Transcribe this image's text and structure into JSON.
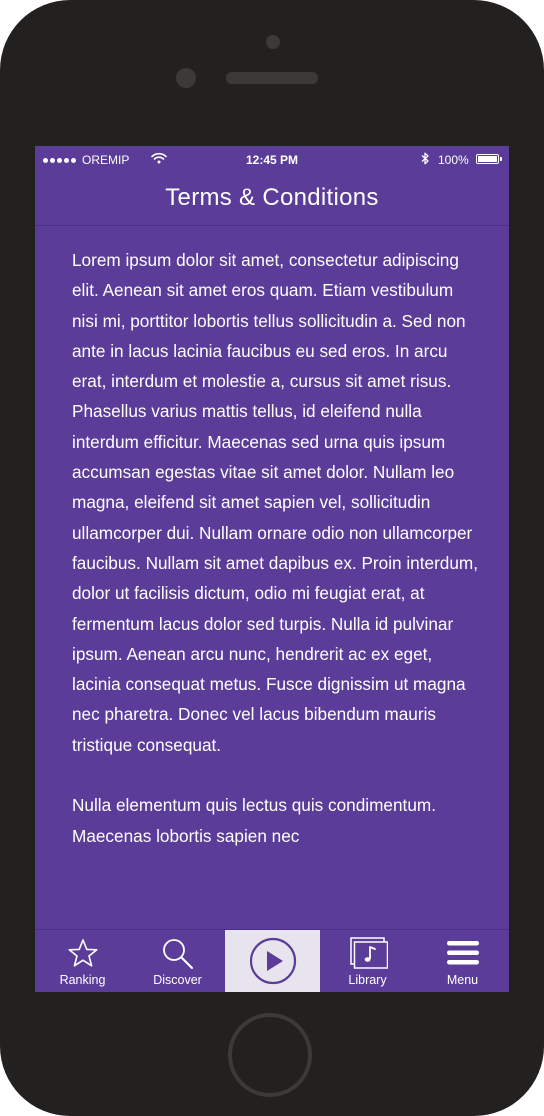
{
  "status_bar": {
    "carrier": "OREMIP",
    "time": "12:45 PM",
    "battery": "100%"
  },
  "header": {
    "title": "Terms & Conditions"
  },
  "content": {
    "paragraphs": [
      "Lorem ipsum dolor sit amet, consectetur adipiscing elit. Aenean sit amet eros quam. Etiam vestibulum nisi mi, porttitor lobortis tellus sollicitudin a. Sed non ante in lacus lacinia faucibus eu sed eros. In arcu erat, interdum et molestie a, cursus sit amet risus. Phasellus varius mattis tellus, id eleifend nulla interdum efficitur. Maecenas sed urna quis ipsum accumsan egestas vitae sit amet dolor. Nullam leo magna, eleifend sit amet sapien vel, sollicitudin ullamcorper dui. Nullam ornare odio non ullamcorper faucibus. Nullam sit amet dapibus ex. Proin interdum, dolor ut facilisis dictum, odio mi feugiat erat, at fermentum lacus dolor sed turpis. Nulla id pulvinar ipsum. Aenean arcu nunc, hendrerit ac ex eget, lacinia consequat metus. Fusce dignissim ut magna nec pharetra. Donec vel lacus bibendum mauris tristique consequat.",
      "Nulla elementum quis lectus quis condimentum. Maecenas lobortis sapien nec"
    ]
  },
  "tab_bar": {
    "items": [
      {
        "label": "Ranking",
        "icon": "star-icon"
      },
      {
        "label": "Discover",
        "icon": "search-icon"
      },
      {
        "label": "",
        "icon": "play-icon"
      },
      {
        "label": "Library",
        "icon": "music-library-icon"
      },
      {
        "label": "Menu",
        "icon": "hamburger-menu-icon"
      }
    ]
  },
  "colors": {
    "background": "#5b3c98",
    "active_tab": "#e7e4ee",
    "phone_frame": "#222120",
    "text": "#ffffff"
  }
}
